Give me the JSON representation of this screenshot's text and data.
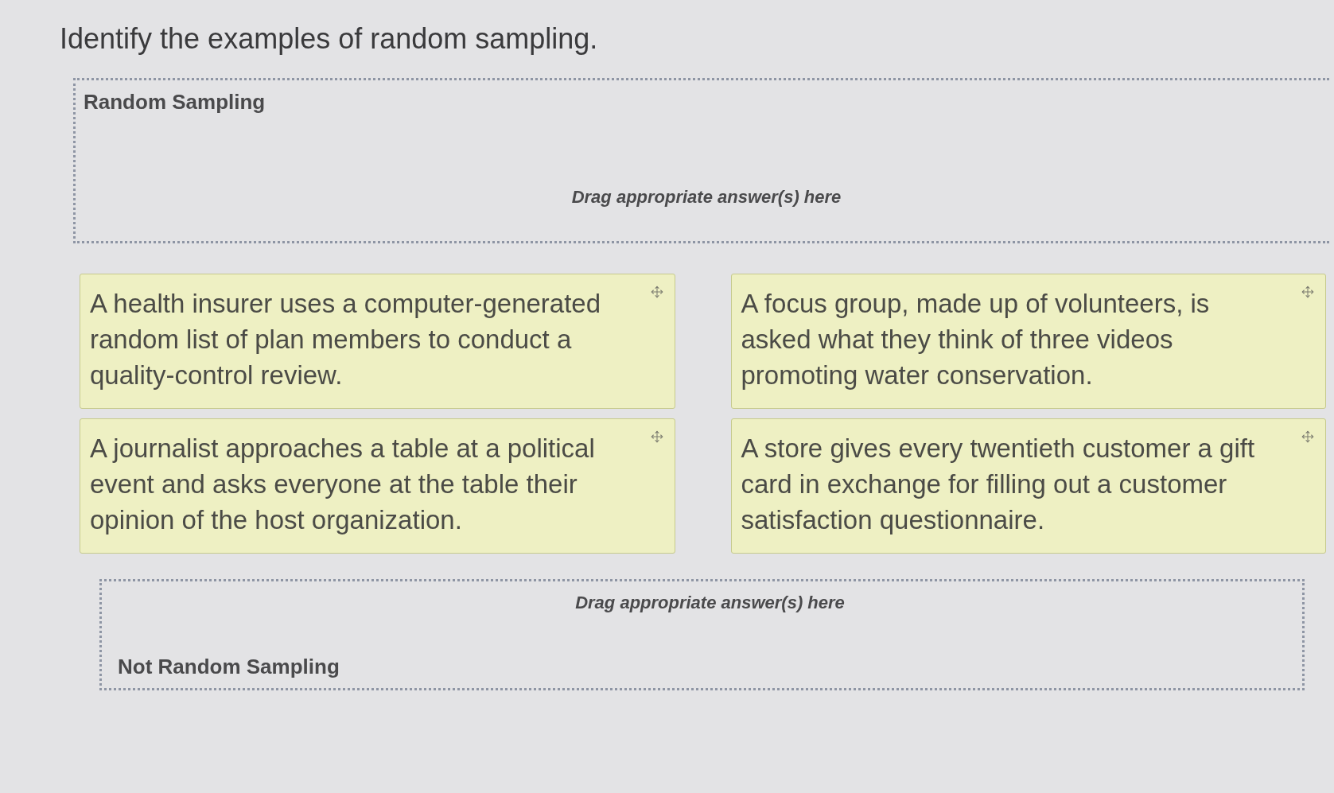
{
  "title": "Identify the examples of random sampling.",
  "drop_zone_top": {
    "label": "Random Sampling",
    "hint": "Drag appropriate answer(s) here"
  },
  "answer_cards": [
    {
      "text": "A health insurer uses a computer-generated random list of plan members to conduct a quality-control review."
    },
    {
      "text": "A focus group, made up of volunteers, is asked what they think of three videos promoting water conservation."
    },
    {
      "text": "A journalist approaches a table at a political event and asks everyone at the table their opinion of the host organization."
    },
    {
      "text": "A store gives every twentieth customer a gift card in exchange for filling out a customer satisfaction questionnaire."
    }
  ],
  "drop_zone_bottom": {
    "label": "Not Random Sampling",
    "hint": "Drag appropriate answer(s) here"
  }
}
